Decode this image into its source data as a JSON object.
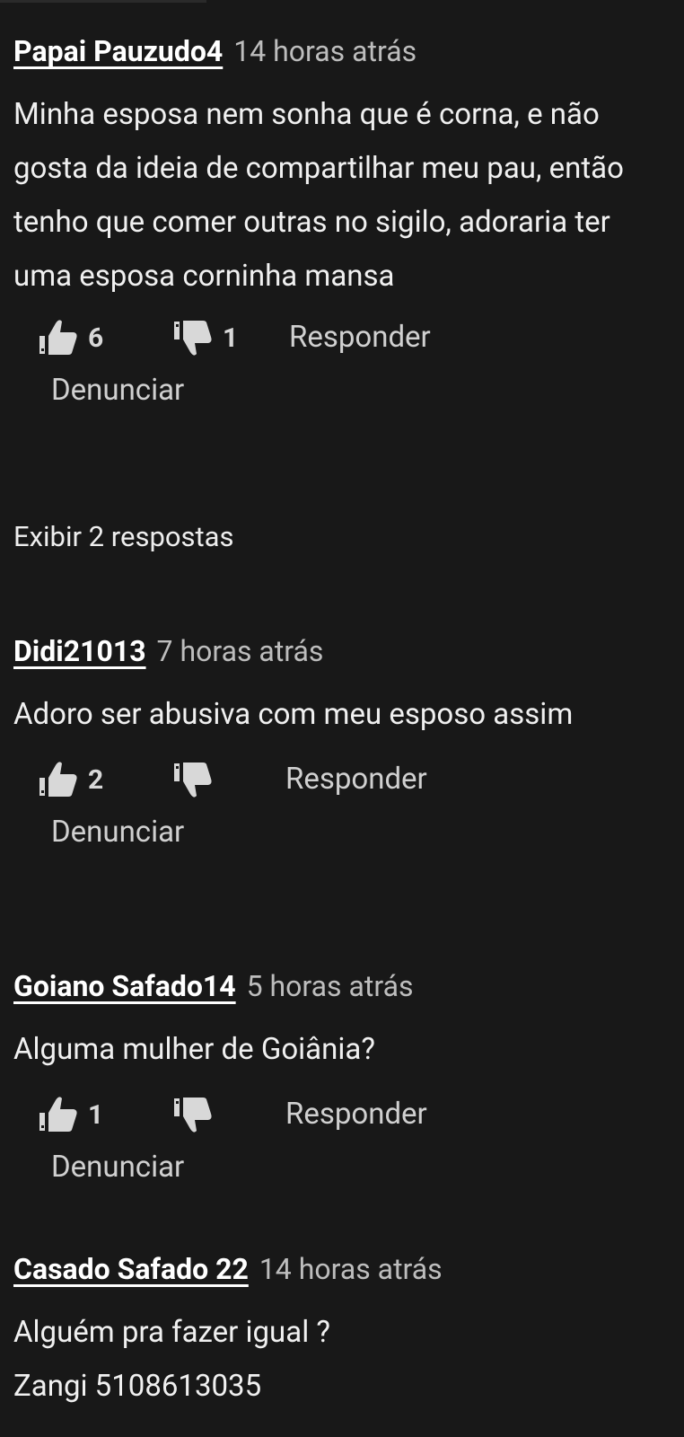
{
  "comments": [
    {
      "author": "Papai Pauzudo4",
      "time": "14 horas atrás",
      "text": "Minha esposa nem sonha que é corna, e não gosta da ideia de compartilhar meu pau, então tenho que comer outras no sigilo, adoraria ter uma esposa corninha mansa",
      "likes": "6",
      "dislikes": "1",
      "reply_label": "Responder",
      "report_label": "Denunciar"
    },
    {
      "author": "Didi21013",
      "time": "7 horas atrás",
      "text": "Adoro ser abusiva com meu esposo assim",
      "likes": "2",
      "dislikes": "",
      "reply_label": "Responder",
      "report_label": "Denunciar"
    },
    {
      "author": "Goiano Safado14",
      "time": "5 horas atrás",
      "text": "Alguma mulher de Goiânia?",
      "likes": "1",
      "dislikes": "",
      "reply_label": "Responder",
      "report_label": "Denunciar"
    },
    {
      "author": "Casado Safado 22",
      "time": "14 horas atrás",
      "text": "Alguém pra fazer igual ?\nZangi 5108613035"
    }
  ],
  "show_replies_label": "Exibir 2 respostas",
  "icons": {
    "like": "thumbs-up-icon",
    "dislike": "thumbs-down-icon"
  },
  "colors": {
    "background": "#181818",
    "text": "#f0f0f0",
    "muted": "#bdbdbd",
    "icon": "#d8d8d8"
  }
}
